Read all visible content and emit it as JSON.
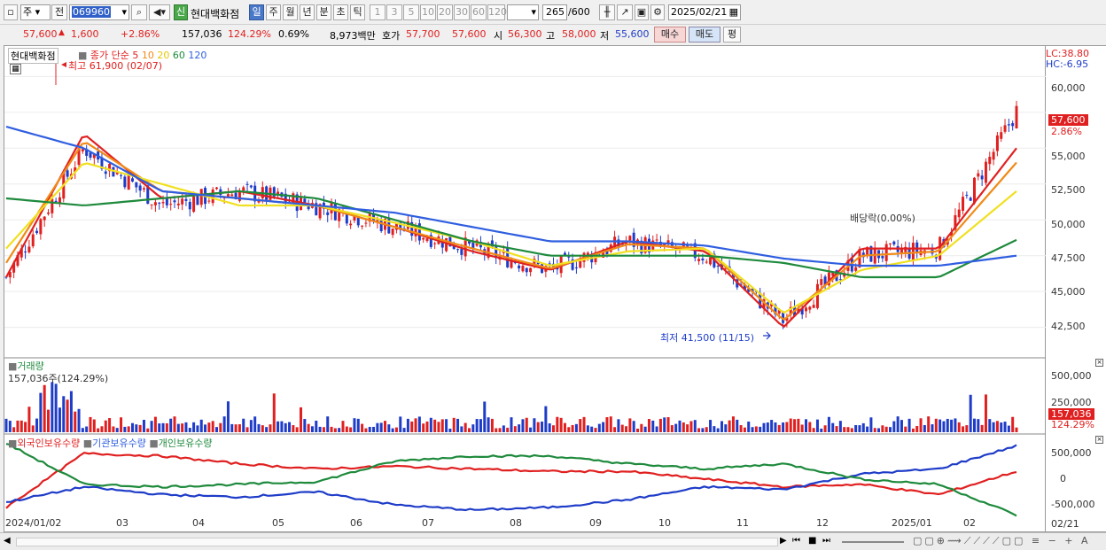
{
  "toolbar1": {
    "type_sel": "주",
    "prev_label": "전",
    "code": "069960",
    "badge_new": "신",
    "stock_name": "현대백화점",
    "periods": [
      "일",
      "주",
      "월",
      "년",
      "분",
      "초",
      "틱"
    ],
    "active_period": "일",
    "intervals": [
      "1",
      "3",
      "5",
      "10",
      "20",
      "30",
      "60",
      "120"
    ],
    "count": "265",
    "count_total": "/600",
    "date": "2025/02/21"
  },
  "quote": {
    "price": "57,600",
    "arrow": "▲",
    "change": "1,600",
    "change_pct": "+2.86%",
    "volume": "157,036",
    "volume_ratio": "124.29%",
    "turnover": "0.69%",
    "amount": "8,973백만",
    "bid_label": "호가",
    "bid_ask": "57,700",
    "bid_bid": "57,600",
    "open_label": "시",
    "open": "56,300",
    "high_label": "고",
    "high": "58,000",
    "low_label": "저",
    "low": "55,600",
    "buy_btn": "매수",
    "sell_btn": "매도",
    "eval_btn": "평"
  },
  "price_panel": {
    "name": "현대백화점",
    "ma_title": "종가 단순",
    "ma_periods": [
      "5",
      "10",
      "20",
      "60",
      "120"
    ],
    "high_note": "최고 61,900 (02/07)",
    "low_note": "최저 41,500 (11/15)",
    "dividend_note": "배당락(0.00%)",
    "lc": "LC:38.80",
    "hc": "HC:-6.95",
    "price_tag": "57,600",
    "pct_tag": "2.86%",
    "yticks": [
      "60,000",
      "57,500",
      "55,000",
      "52,500",
      "50,000",
      "47,500",
      "45,000",
      "42,500"
    ]
  },
  "volume_panel": {
    "title": "거래량",
    "value": "157,036주(124.29%)",
    "yticks": [
      "500,000",
      "250,000"
    ],
    "tag": "157,036",
    "tag_pct": "124.29%"
  },
  "holdings_panel": {
    "series": [
      "외국인보유수량",
      "기관보유수량",
      "개인보유수량"
    ],
    "yticks": [
      "500,000",
      "0",
      "-500,000"
    ]
  },
  "xaxis": {
    "labels": [
      "2024/01/02",
      "03",
      "04",
      "05",
      "06",
      "07",
      "08",
      "09",
      "10",
      "11",
      "12",
      "2025/01",
      "02"
    ],
    "right_label": "02/21"
  },
  "colors": {
    "up": "#e02020",
    "down": "#1e3cc8",
    "ma5": "#e02020",
    "ma10": "#f08a18",
    "ma20": "#f0e020",
    "ma60": "#1e8a3c",
    "ma120": "#2f5ee0"
  },
  "chart_data": {
    "type": "line",
    "ylim": [
      40500,
      62000
    ],
    "x_months": [
      "2024/01",
      "02",
      "03",
      "04",
      "05",
      "06",
      "07",
      "08",
      "09",
      "10",
      "11",
      "12",
      "2025/01",
      "02"
    ],
    "close_approx": [
      46000,
      55000,
      51000,
      52000,
      51000,
      49500,
      48000,
      46500,
      48500,
      47500,
      43000,
      47500,
      48000,
      57600
    ],
    "series": [
      {
        "name": "5",
        "values": [
          46000,
          56000,
          51500,
          52000,
          51000,
          49500,
          47800,
          46500,
          48500,
          47800,
          42500,
          48000,
          48000,
          55000
        ]
      },
      {
        "name": "10",
        "values": [
          47000,
          55500,
          52000,
          51500,
          51000,
          49500,
          48000,
          46600,
          48300,
          48000,
          43000,
          47500,
          47800,
          54000
        ]
      },
      {
        "name": "20",
        "values": [
          48000,
          54000,
          52500,
          51000,
          51000,
          49800,
          48500,
          46800,
          47800,
          48000,
          43500,
          46500,
          47500,
          52000
        ]
      },
      {
        "name": "60",
        "values": [
          51500,
          51000,
          51500,
          52000,
          51500,
          50000,
          48500,
          47500,
          47500,
          47500,
          47000,
          46000,
          46000,
          48600
        ]
      },
      {
        "name": "120",
        "values": [
          56500,
          55000,
          52000,
          51500,
          51000,
          50500,
          49500,
          48500,
          48500,
          48200,
          47300,
          46800,
          46800,
          47500
        ]
      }
    ]
  }
}
